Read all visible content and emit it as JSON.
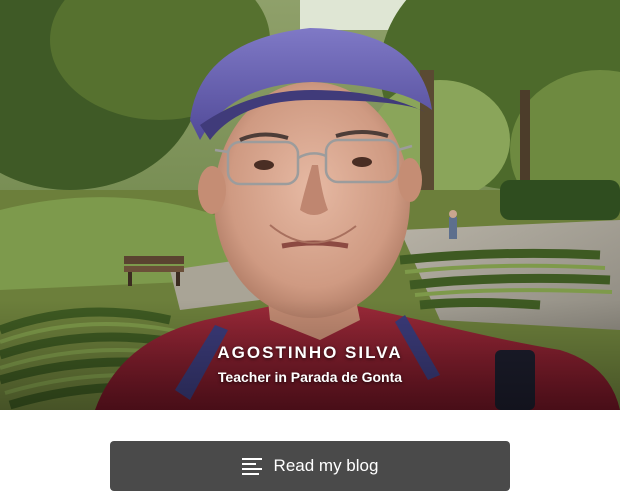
{
  "profile": {
    "name": "AGOSTINHO SILVA",
    "subtitle": "Teacher in Parada de Gonta",
    "photo_icon": "profile-photo"
  },
  "action": {
    "label": "Read my blog",
    "icon": "blog-lines-icon"
  },
  "colors": {
    "button_bg": "#4a4a4a",
    "text": "#ffffff",
    "page_bg": "#ffffff"
  }
}
